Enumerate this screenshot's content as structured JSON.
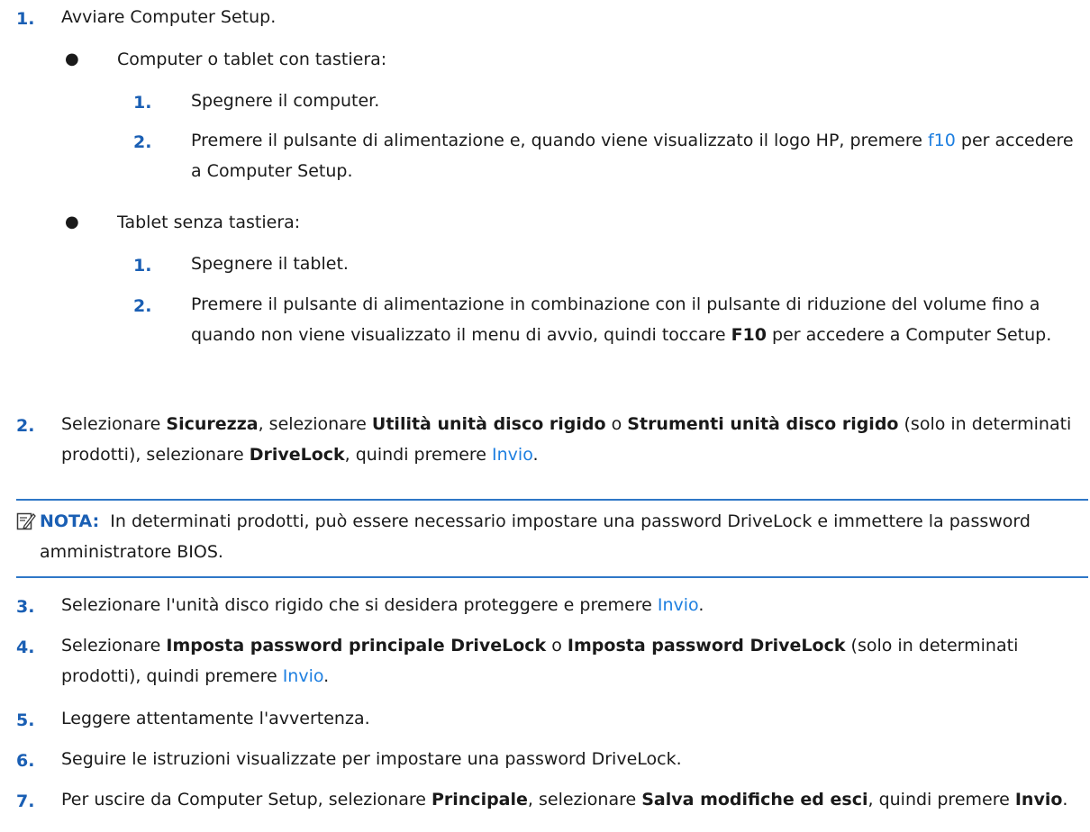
{
  "steps": [
    {
      "num": "1.",
      "text": "Avviare Computer Setup."
    },
    {
      "num": "2.",
      "parts": [
        "Selezionare ",
        "Sicurezza",
        ", selezionare ",
        "Utilità unità disco rigido",
        " o ",
        "Strumenti unità disco rigido",
        " (solo in determinati prodotti), selezionare ",
        "DriveLock",
        ", quindi premere ",
        "Invio",
        "."
      ]
    },
    {
      "num": "3.",
      "parts": [
        "Selezionare l'unità disco rigido che si desidera proteggere e premere ",
        "Invio",
        "."
      ]
    },
    {
      "num": "4.",
      "parts": [
        "Selezionare ",
        "Imposta password principale DriveLock",
        " o ",
        "Imposta password DriveLock",
        " (solo in determinati prodotti), quindi premere ",
        "Invio",
        "."
      ]
    },
    {
      "num": "5.",
      "text": "Leggere attentamente l'avvertenza."
    },
    {
      "num": "6.",
      "text": "Seguire le istruzioni visualizzate per impostare una password DriveLock."
    },
    {
      "num": "7.",
      "parts": [
        "Per uscire da Computer Setup, selezionare ",
        "Principale",
        ", selezionare ",
        "Salva modifiche ed esci",
        ", quindi premere ",
        "Invio",
        "."
      ]
    }
  ],
  "bullets": [
    {
      "text": "Computer o tablet con tastiera:",
      "substeps": [
        {
          "num": "1.",
          "text": "Spegnere il computer."
        },
        {
          "num": "2.",
          "parts": [
            "Premere il pulsante di alimentazione e, quando viene visualizzato il logo HP, premere ",
            "f10",
            " per accedere a Computer Setup."
          ]
        }
      ]
    },
    {
      "text": "Tablet senza tastiera:",
      "substeps": [
        {
          "num": "1.",
          "text": "Spegnere il tablet."
        },
        {
          "num": "2.",
          "parts": [
            "Premere il pulsante di alimentazione in combinazione con il pulsante di riduzione del volume fino a quando non viene visualizzato il menu di avvio, quindi toccare ",
            "F10",
            " per accedere a Computer Setup."
          ]
        }
      ]
    }
  ],
  "note": {
    "label": "NOTA:",
    "text": "In determinati prodotti, può essere necessario impostare una password DriveLock e immettere la password amministratore BIOS.",
    "icon": "note-pencil-icon"
  },
  "colors": {
    "accent": "#1a5fb4",
    "link": "#1e7fe0",
    "rule": "#2f77c7"
  }
}
